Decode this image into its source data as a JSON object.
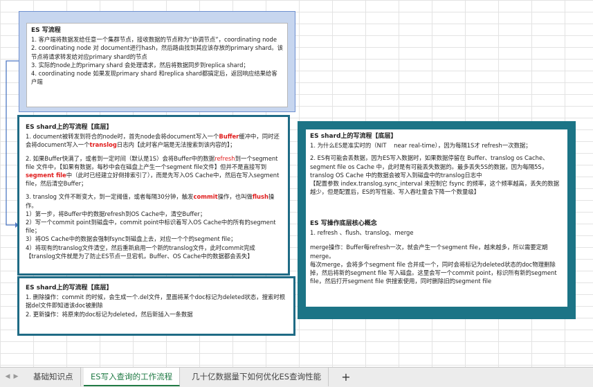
{
  "card1": {
    "title": "ES 写流程",
    "lines": [
      "1. 客户端将数据发给任意一个集群节点，接收数据的节点称为“协调节点”，coordinating node",
      "2. coordinating node 对 document进行hash，然后路由找到其应该存放的primary shard。该节点将请求转发给对应primary shard的节点",
      "3. 实际的node上的primary shard 会处理请求，然后将数据同步到replica shard；",
      "4. coordinating node 如果发现primary shard 和replica shard都搞定后，返回响应结果给客户端"
    ]
  },
  "card2": {
    "title": "ES shard上的写流程【底层】",
    "p1_a": "1. document被转发到符合的node时，首先node会将document写入一个",
    "p1_b": "Buffer",
    "p1_c": "缓冲中，同时还会将document写入一个",
    "p1_d": "translog",
    "p1_e": "日志内【此时客户端是无法搜索到该内容的】；",
    "p2_a": "2. 如果Buffer快满了，或者到一定时间（默认是1S）会将Buffer中的数据",
    "p2_b": "refresh",
    "p2_c": "到一个segment file 文件中，【如果有数据，每秒中会在磁盘上产生一个segment file文件】但并不是直接写到",
    "p2_d": "segment file",
    "p2_e": "中（此时已经建立好倒排索引了），而是先写入OS Cache中，然后在写入segment file，然后清空Buffer；",
    "p3_a": "3. translog 文件不断变大，到一定阈值，或者每隔30分钟，触发",
    "p3_b": "commit",
    "p3_c": "操作，也叫做",
    "p3_d": "flush",
    "p3_e": "操作。",
    "steps": [
      "1）第一步，将Buffer中的数据refresh到OS Cache中，清空Buffer；",
      "2）写一个commit point到磁盘中，commit point中标识着写入OS Cache中的所有的segment file；",
      "3）将OS Cache中的数据会强制fsync到磁盘上去，对应一个个的segment file；",
      "4）将现有的translog文件清空，然后重新启用一个新的translog文件，此时commit完成",
      "【translog文件就是为了防止ES节点一旦宕机，Buffer、OS Cache中的数据都会丢失】"
    ]
  },
  "card3": {
    "title": "ES shard上的写流程【底层】",
    "lines": [
      "1. 删除操作：commit 的时候，会生成一个.del文件，里面将某个doc标记为deleted状态，搜索时根据del文件即知道该doc被删除",
      "2. 更新操作：将原来的doc标记为deleted，然后新插入一条数据"
    ]
  },
  "card4": {
    "title": "ES shard上的写流程【底层】",
    "lines": [
      "1. 为什么ES是准实时的（NIT    near real-time），因为每隔1S才 refresh一次数据；",
      "",
      "2. ES有可能会丢数据，因为ES写入数据时，如果数据停留在 Buffer、translog os Cache、segment file os Cache 中，此时是有可能丢失数据的。最多丢失5S的数据，因为每隔5S，translog OS Cache 中的数据会被写入到磁盘中的translog日志中",
      "【配置参数 index.translog.sync_interval 来控制它 fsync 的频率，这个频率越高，丢失的数据越少，但是配置后，ES的写性能、写入吞吐量会下降一个数量级】"
    ]
  },
  "card5": {
    "title": "ES 写操作底层核心概念",
    "lines": [
      "1. refresh 、flush、translog、merge",
      "",
      "merge操作：Buffer每refresh一次，就会产生一个segment file，越来越多，所以需要定期merge。",
      "每次merge，会将多个segment file 合并成一个，同时会将标记为deleted状态的doc物理删除掉，然后将新的segment file 写入磁盘。这里会写一个commit point，标识所有新的segment file，然后打开segment file 供搜索使用，同时删除旧的segment file"
    ]
  },
  "tabs": [
    {
      "label": "基础知识点",
      "active": false
    },
    {
      "label": "ES写入查询的工作流程",
      "active": true
    },
    {
      "label": "几十亿数据量下如何优化ES查询性能",
      "active": false
    }
  ],
  "add_tab_label": "+",
  "colors": {
    "accent_teal": "#1f6b85",
    "card_blue": "#c7d6ef",
    "highlight_red": "#e01b1b",
    "active_tab_green": "#1f7a44"
  }
}
